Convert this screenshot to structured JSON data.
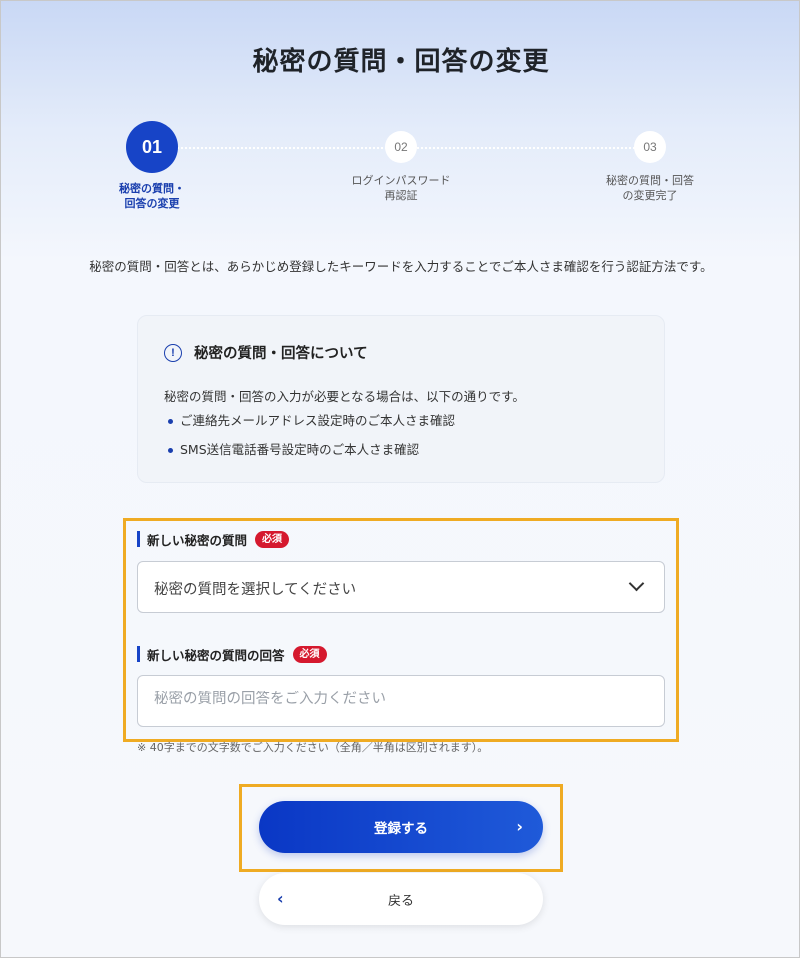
{
  "page": {
    "title": "秘密の質問・回答の変更"
  },
  "stepper": {
    "steps": [
      {
        "number": "01",
        "label": "秘密の質問・\n回答の変更",
        "state": "active"
      },
      {
        "number": "02",
        "label": "ログインパスワード\n再認証",
        "state": "inactive"
      },
      {
        "number": "03",
        "label": "秘密の質問・回答\nの変更完了",
        "state": "inactive"
      }
    ]
  },
  "intro": {
    "text": "秘密の質問・回答とは、あらかじめ登録したキーワードを入力することでご本人さま確認を行う認証方法です。"
  },
  "info_box": {
    "icon": "info-circle-icon",
    "icon_glyph": "!",
    "title": "秘密の質問・回答について",
    "lead": "秘密の質問・回答の入力が必要となる場合は、以下の通りです。",
    "items": [
      "ご連絡先メールアドレス設定時のご本人さま確認",
      "SMS送信電話番号設定時のご本人さま確認"
    ]
  },
  "form": {
    "question": {
      "label": "新しい秘密の質問",
      "required_badge": "必須",
      "selected_value": "秘密の質問を選択してください"
    },
    "answer": {
      "label": "新しい秘密の質問の回答",
      "required_badge": "必須",
      "value": "",
      "placeholder": "秘密の質問の回答をご入力ください"
    },
    "note": "※ 40字までの文字数でご入力ください（全角／半角は区別されます）。"
  },
  "buttons": {
    "submit": {
      "label": "登録する",
      "icon": "chevron-right-icon",
      "glyph": "›"
    },
    "back": {
      "label": "戻る",
      "icon": "chevron-left-icon",
      "glyph": "‹"
    }
  },
  "colors": {
    "accent": "#1744c7",
    "required": "#d5192e",
    "highlight": "#efab23"
  }
}
